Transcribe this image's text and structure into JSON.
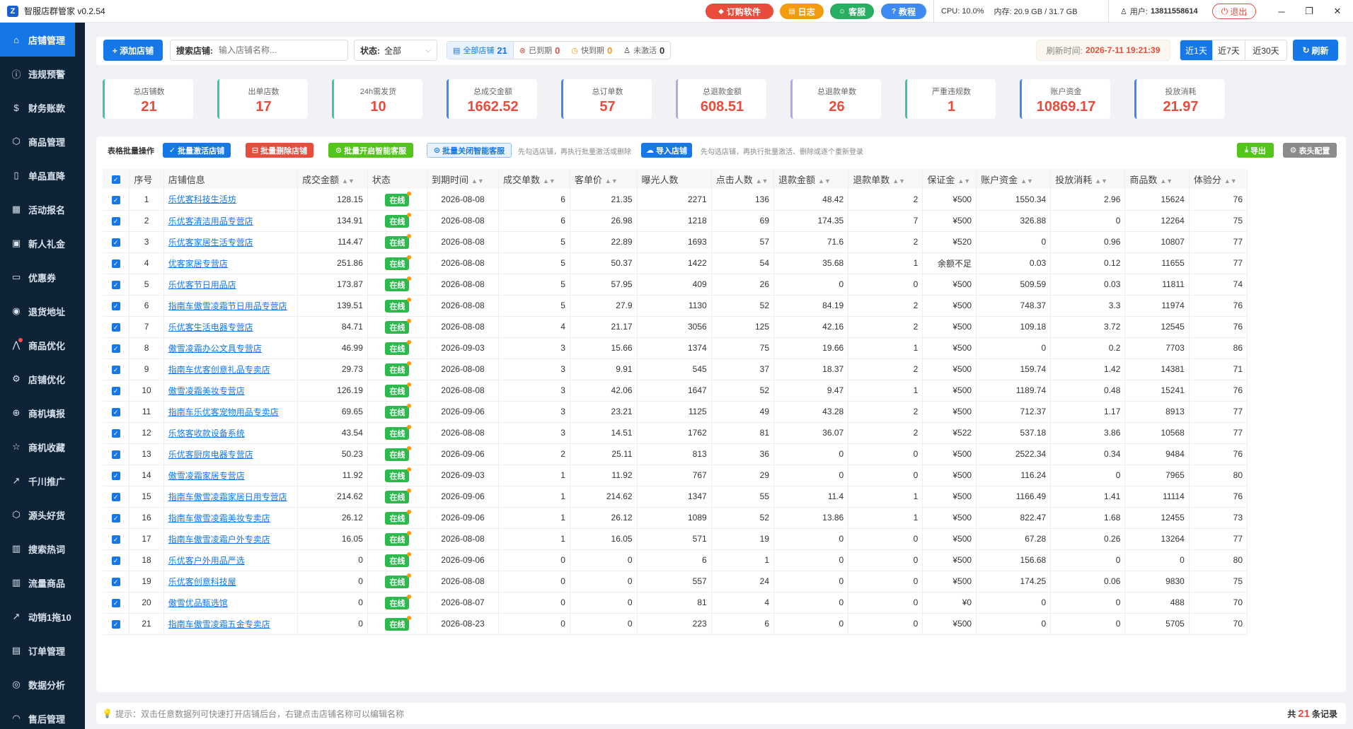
{
  "app": {
    "logo": "Z",
    "title": "智服店群管家 v0.2.54"
  },
  "titlebar": {
    "buttons": [
      {
        "icon": "diamond-icon",
        "glyph": "◆",
        "label": "订购软件",
        "color": "#e74c3c"
      },
      {
        "icon": "log-icon",
        "glyph": "▤",
        "label": "日志",
        "color": "#f39c12"
      },
      {
        "icon": "chat-icon",
        "glyph": "☺",
        "label": "客服",
        "color": "#27ae60"
      },
      {
        "icon": "question-icon",
        "glyph": "?",
        "label": "教程",
        "color": "#3d8bf2"
      }
    ],
    "cpu_label": "CPU:",
    "cpu_value": "10.0%",
    "mem_label": "内存:",
    "mem_value": "20.9 GB / 31.7 GB",
    "user_label": "用户:",
    "user_value": "13811558614",
    "logout": "退出",
    "win": {
      "min": "─",
      "max": "❐",
      "close": "✕"
    }
  },
  "sidebar": {
    "items": [
      {
        "icon": "home-icon",
        "glyph": "⌂",
        "label": "店铺管理",
        "active": true
      },
      {
        "icon": "warning-icon",
        "glyph": "ⓘ",
        "label": "违规预警"
      },
      {
        "icon": "dollar-icon",
        "glyph": "$",
        "label": "财务账款"
      },
      {
        "icon": "box-icon",
        "glyph": "⬡",
        "label": "商品管理"
      },
      {
        "icon": "book-icon",
        "glyph": "▯",
        "label": "单品直降"
      },
      {
        "icon": "calendar-icon",
        "glyph": "▦",
        "label": "活动报名"
      },
      {
        "icon": "gift-icon",
        "glyph": "▣",
        "label": "新人礼金"
      },
      {
        "icon": "coupon-icon",
        "glyph": "▭",
        "label": "优惠券"
      },
      {
        "icon": "location-icon",
        "glyph": "◉",
        "label": "退货地址"
      },
      {
        "icon": "trend-icon",
        "glyph": "⋀",
        "label": "商品优化",
        "dot": true
      },
      {
        "icon": "gear-icon",
        "glyph": "⚙",
        "label": "店铺优化"
      },
      {
        "icon": "upload-icon",
        "glyph": "⊕",
        "label": "商机填报"
      },
      {
        "icon": "star-icon",
        "glyph": "☆",
        "label": "商机收藏"
      },
      {
        "icon": "chart-up-icon",
        "glyph": "↗",
        "label": "千川推广"
      },
      {
        "icon": "cube-icon",
        "glyph": "⬡",
        "label": "源头好货"
      },
      {
        "icon": "bar-chart-icon",
        "glyph": "▥",
        "label": "搜索热词"
      },
      {
        "icon": "bar-chart-icon",
        "glyph": "▥",
        "label": "流量商品"
      },
      {
        "icon": "trend-icon",
        "glyph": "↗",
        "label": "动销1拖10"
      },
      {
        "icon": "file-icon",
        "glyph": "▤",
        "label": "订单管理"
      },
      {
        "icon": "chat-icon",
        "glyph": "◎",
        "label": "数据分析"
      },
      {
        "icon": "headset-icon",
        "glyph": "◠",
        "label": "售后管理"
      }
    ]
  },
  "toolbar": {
    "add_label": "+ 添加店铺",
    "search_label": "搜索店铺:",
    "search_placeholder": "输入店铺名称...",
    "status_label": "状态:",
    "status_value": "全部",
    "filters": [
      {
        "icon": "list-icon",
        "glyph": "▤",
        "label": "全部店铺",
        "count": "21",
        "color": "#1677e6",
        "active": true
      },
      {
        "icon": "expired-icon",
        "glyph": "⊗",
        "label": "已到期",
        "count": "0",
        "color": "#e74c3c"
      },
      {
        "icon": "clock-icon",
        "glyph": "◷",
        "label": "快到期",
        "count": "0",
        "color": "#f39c12"
      },
      {
        "icon": "inactive-icon",
        "glyph": "♙",
        "label": "未激活",
        "count": "0",
        "color": "#333"
      }
    ],
    "refresh_time_label": "刷新时间:",
    "refresh_time": "2026-7-11 19:21:39",
    "ranges": [
      {
        "label": "近1天",
        "active": true
      },
      {
        "label": "近7天"
      },
      {
        "label": "近30天"
      }
    ],
    "refresh_label": "刷新"
  },
  "stats": [
    {
      "label": "总店铺数",
      "value": "21",
      "color": "#e74c3c"
    },
    {
      "label": "出单店数",
      "value": "17",
      "color": "#e74c3c"
    },
    {
      "label": "24h需发货",
      "value": "10",
      "color": "#e74c3c"
    },
    {
      "label": "总成交金额",
      "value": "1662.52",
      "color": "#e74c3c"
    },
    {
      "label": "总订单数",
      "value": "57",
      "color": "#e74c3c"
    },
    {
      "label": "总退款金额",
      "value": "608.51",
      "color": "#e74c3c"
    },
    {
      "label": "总退款单数",
      "value": "26",
      "color": "#e74c3c"
    },
    {
      "label": "严重违规数",
      "value": "1",
      "color": "#e74c3c"
    },
    {
      "label": "账户资金",
      "value": "10869.17",
      "color": "#e74c3c"
    },
    {
      "label": "投放消耗",
      "value": "21.97",
      "color": "#e74c3c"
    }
  ],
  "batch": {
    "label": "表格批量操作",
    "btn_activate": "批量激活店铺",
    "btn_delete": "批量删除店铺",
    "btn_open_ai": "批量开启智能客服",
    "btn_close_ai": "批量关闭智能客服",
    "hint1": "先勾选店铺，再执行批量激活或删除",
    "btn_import": "导入店铺",
    "hint2": "先勾选店铺，再执行批量激活、删除或逐个重新登录",
    "btn_export": "导出",
    "btn_columns": "表头配置"
  },
  "table": {
    "headers": [
      "序号",
      "店铺信息",
      "成交金额",
      "状态",
      "到期时间",
      "成交单数",
      "客单价",
      "曝光人数",
      "点击人数",
      "退款金额",
      "退款单数",
      "保证金",
      "账户资金",
      "投放消耗",
      "商品数",
      "体验分"
    ],
    "rows": [
      [
        "1",
        "乐优客科技生活坊",
        "128.15",
        "在线",
        "2026-08-08",
        "6",
        "21.35",
        "2271",
        "136",
        "48.42",
        "2",
        "¥500",
        "1550.34",
        "2.96",
        "15624",
        "76"
      ],
      [
        "2",
        "乐优客清洁用品专营店",
        "134.91",
        "在线",
        "2026-08-08",
        "6",
        "26.98",
        "1218",
        "69",
        "174.35",
        "7",
        "¥500",
        "326.88",
        "0",
        "12264",
        "75"
      ],
      [
        "3",
        "乐优客家居生活专营店",
        "114.47",
        "在线",
        "2026-08-08",
        "5",
        "22.89",
        "1693",
        "57",
        "71.6",
        "2",
        "¥520",
        "0",
        "0.96",
        "10807",
        "77"
      ],
      [
        "4",
        "优客家居专营店",
        "251.86",
        "在线",
        "2026-08-08",
        "5",
        "50.37",
        "1422",
        "54",
        "35.68",
        "1",
        "余额不足",
        "0.03",
        "0.12",
        "11655",
        "77"
      ],
      [
        "5",
        "乐优客节日用品店",
        "173.87",
        "在线",
        "2026-08-08",
        "5",
        "57.95",
        "409",
        "26",
        "0",
        "0",
        "¥500",
        "509.59",
        "0.03",
        "11811",
        "74"
      ],
      [
        "6",
        "指南车傲雪凌霜节日用品专营店",
        "139.51",
        "在线",
        "2026-08-08",
        "5",
        "27.9",
        "1130",
        "52",
        "84.19",
        "2",
        "¥500",
        "748.37",
        "3.3",
        "11974",
        "76"
      ],
      [
        "7",
        "乐优客生活电器专营店",
        "84.71",
        "在线",
        "2026-08-08",
        "4",
        "21.17",
        "3056",
        "125",
        "42.16",
        "2",
        "¥500",
        "109.18",
        "3.72",
        "12545",
        "76"
      ],
      [
        "8",
        "傲雪凌霜办公文具专营店",
        "46.99",
        "在线",
        "2026-09-03",
        "3",
        "15.66",
        "1374",
        "75",
        "19.66",
        "1",
        "¥500",
        "0",
        "0.2",
        "7703",
        "86"
      ],
      [
        "9",
        "指南车优客创意礼品专卖店",
        "29.73",
        "在线",
        "2026-08-08",
        "3",
        "9.91",
        "545",
        "37",
        "18.37",
        "2",
        "¥500",
        "159.74",
        "1.42",
        "14381",
        "71"
      ],
      [
        "10",
        "傲雪凌霜美妆专营店",
        "126.19",
        "在线",
        "2026-08-08",
        "3",
        "42.06",
        "1647",
        "52",
        "9.47",
        "1",
        "¥500",
        "1189.74",
        "0.48",
        "15241",
        "76"
      ],
      [
        "11",
        "指南车乐优客宠物用品专卖店",
        "69.65",
        "在线",
        "2026-09-06",
        "3",
        "23.21",
        "1125",
        "49",
        "43.28",
        "2",
        "¥500",
        "712.37",
        "1.17",
        "8913",
        "77"
      ],
      [
        "12",
        "乐悠客收款设备系统",
        "43.54",
        "在线",
        "2026-08-08",
        "3",
        "14.51",
        "1762",
        "81",
        "36.07",
        "2",
        "¥522",
        "537.18",
        "3.86",
        "10568",
        "77"
      ],
      [
        "13",
        "乐优客厨房电器专营店",
        "50.23",
        "在线",
        "2026-09-06",
        "2",
        "25.11",
        "813",
        "36",
        "0",
        "0",
        "¥500",
        "2522.34",
        "0.34",
        "9484",
        "76"
      ],
      [
        "14",
        "傲雪凌霜家居专营店",
        "11.92",
        "在线",
        "2026-09-03",
        "1",
        "11.92",
        "767",
        "29",
        "0",
        "0",
        "¥500",
        "116.24",
        "0",
        "7965",
        "80"
      ],
      [
        "15",
        "指南车傲雪凌霜家居日用专营店",
        "214.62",
        "在线",
        "2026-09-06",
        "1",
        "214.62",
        "1347",
        "55",
        "11.4",
        "1",
        "¥500",
        "1166.49",
        "1.41",
        "11114",
        "76"
      ],
      [
        "16",
        "指南车傲雪凌霜美妆专卖店",
        "26.12",
        "在线",
        "2026-09-06",
        "1",
        "26.12",
        "1089",
        "52",
        "13.86",
        "1",
        "¥500",
        "822.47",
        "1.68",
        "12455",
        "73"
      ],
      [
        "17",
        "指南车傲雪凌霜户外专卖店",
        "16.05",
        "在线",
        "2026-08-08",
        "1",
        "16.05",
        "571",
        "19",
        "0",
        "0",
        "¥500",
        "67.28",
        "0.26",
        "13264",
        "77"
      ],
      [
        "18",
        "乐优客户外用品严选",
        "0",
        "在线",
        "2026-09-06",
        "0",
        "0",
        "6",
        "1",
        "0",
        "0",
        "¥500",
        "156.68",
        "0",
        "0",
        "80"
      ],
      [
        "19",
        "乐优客创意科技屋",
        "0",
        "在线",
        "2026-08-08",
        "0",
        "0",
        "557",
        "24",
        "0",
        "0",
        "¥500",
        "174.25",
        "0.06",
        "9830",
        "75"
      ],
      [
        "20",
        "傲雪优品甄选馆",
        "0",
        "在线",
        "2026-08-07",
        "0",
        "0",
        "81",
        "4",
        "0",
        "0",
        "¥0",
        "0",
        "0",
        "488",
        "70"
      ],
      [
        "21",
        "指南车傲雪凌霜五金专卖店",
        "0",
        "在线",
        "2026-08-23",
        "0",
        "0",
        "223",
        "6",
        "0",
        "0",
        "¥500",
        "0",
        "0",
        "5705",
        "70"
      ]
    ]
  },
  "footer": {
    "hint": "提示：双击任意数据列可快速打开店铺后台，右键点击店铺名称可以编辑名称",
    "total_prefix": "共",
    "total_count": "21",
    "total_suffix": "条记录"
  }
}
